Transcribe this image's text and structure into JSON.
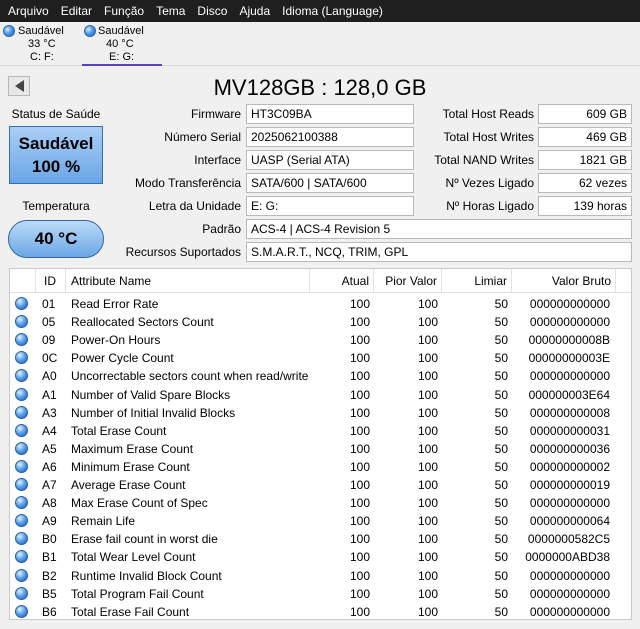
{
  "menu": [
    "Arquivo",
    "Editar",
    "Função",
    "Tema",
    "Disco",
    "Ajuda",
    "Idioma (Language)"
  ],
  "disks": [
    {
      "status": "Saudável",
      "temp": "33 °C",
      "letter": "C: F:"
    },
    {
      "status": "Saudável",
      "temp": "40 °C",
      "letter": "E: G:"
    }
  ],
  "title": "MV128GB : 128,0 GB",
  "health": {
    "status_label": "Status de Saúde",
    "status": "Saudável",
    "percent": "100 %",
    "temp_label": "Temperatura",
    "temp": "40 °C"
  },
  "info": {
    "firmware_label": "Firmware",
    "firmware": "HT3C09BA",
    "serial_label": "Número Serial",
    "serial": "2025062100388",
    "interface_label": "Interface",
    "interface": "UASP (Serial ATA)",
    "transfer_label": "Modo Transferência",
    "transfer": "SATA/600 | SATA/600",
    "drive_letter_label": "Letra da Unidade",
    "drive_letter": "E: G:",
    "standard_label": "Padrão",
    "standard": "ACS-4 | ACS-4 Revision 5",
    "features_label": "Recursos Suportados",
    "features": "S.M.A.R.T., NCQ, TRIM, GPL",
    "host_reads_label": "Total Host Reads",
    "host_reads": "609 GB",
    "host_writes_label": "Total Host Writes",
    "host_writes": "469 GB",
    "nand_writes_label": "Total NAND Writes",
    "nand_writes": "1821 GB",
    "power_on_count_label": "Nº Vezes Ligado",
    "power_on_count": "62 vezes",
    "power_on_hours_label": "Nº Horas Ligado",
    "power_on_hours": "139 horas"
  },
  "table": {
    "headers": [
      "ID",
      "Attribute Name",
      "Atual",
      "Pior Valor",
      "Limiar",
      "Valor Bruto"
    ],
    "rows": [
      [
        "01",
        "Read Error Rate",
        "100",
        "100",
        "50",
        "000000000000"
      ],
      [
        "05",
        "Reallocated Sectors Count",
        "100",
        "100",
        "50",
        "000000000000"
      ],
      [
        "09",
        "Power-On Hours",
        "100",
        "100",
        "50",
        "00000000008B"
      ],
      [
        "0C",
        "Power Cycle Count",
        "100",
        "100",
        "50",
        "00000000003E"
      ],
      [
        "A0",
        "Uncorrectable sectors count when read/write",
        "100",
        "100",
        "50",
        "000000000000"
      ],
      [
        "A1",
        "Number of Valid Spare Blocks",
        "100",
        "100",
        "50",
        "000000003E64"
      ],
      [
        "A3",
        "Number of Initial Invalid Blocks",
        "100",
        "100",
        "50",
        "000000000008"
      ],
      [
        "A4",
        "Total Erase Count",
        "100",
        "100",
        "50",
        "000000000031"
      ],
      [
        "A5",
        "Maximum Erase Count",
        "100",
        "100",
        "50",
        "000000000036"
      ],
      [
        "A6",
        "Minimum Erase Count",
        "100",
        "100",
        "50",
        "000000000002"
      ],
      [
        "A7",
        "Average Erase Count",
        "100",
        "100",
        "50",
        "000000000019"
      ],
      [
        "A8",
        "Max Erase Count of Spec",
        "100",
        "100",
        "50",
        "000000000000"
      ],
      [
        "A9",
        "Remain Life",
        "100",
        "100",
        "50",
        "000000000064"
      ],
      [
        "B0",
        "Erase fail count in worst die",
        "100",
        "100",
        "50",
        "0000000582C5"
      ],
      [
        "B1",
        "Total Wear Level Count",
        "100",
        "100",
        "50",
        "0000000ABD38"
      ],
      [
        "B2",
        "Runtime Invalid Block Count",
        "100",
        "100",
        "50",
        "000000000000"
      ],
      [
        "B5",
        "Total Program Fail Count",
        "100",
        "100",
        "50",
        "000000000000"
      ],
      [
        "B6",
        "Total Erase Fail Count",
        "100",
        "100",
        "50",
        "000000000000"
      ]
    ]
  }
}
